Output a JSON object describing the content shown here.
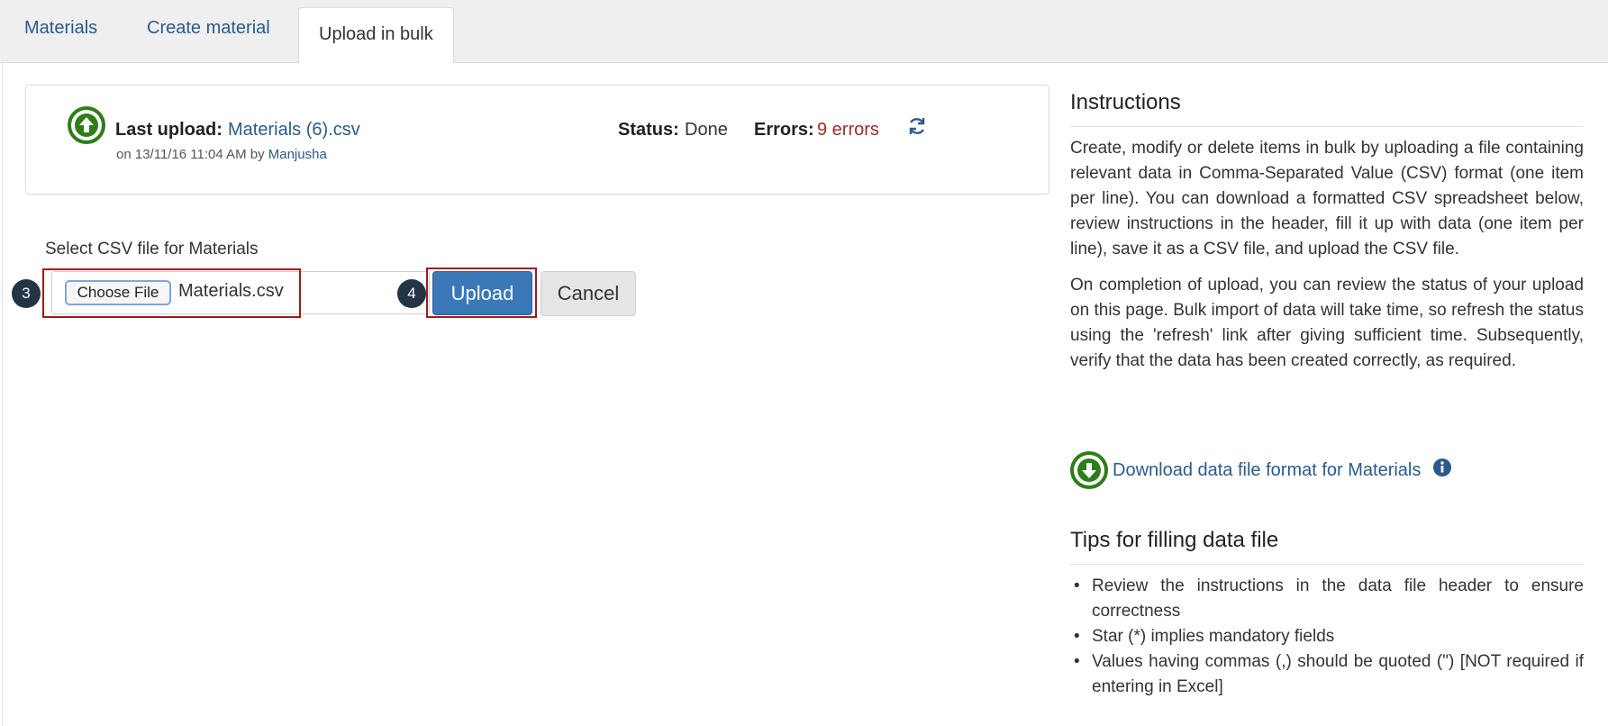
{
  "tabs": [
    {
      "label": "Materials"
    },
    {
      "label": "Create material"
    },
    {
      "label": "Upload in bulk"
    }
  ],
  "last_upload": {
    "label": "Last upload:",
    "file": "Materials (6).csv",
    "meta_prefix": "on 13/11/16 11:04 AM by",
    "user": "Manjusha",
    "status_label": "Status:",
    "status_value": "Done",
    "errors_label": "Errors:",
    "errors_value": "9 errors"
  },
  "upload_form": {
    "select_label": "Select CSV file for Materials",
    "choose_file_label": "Choose File",
    "chosen_file": "Materials.csv",
    "upload_label": "Upload",
    "cancel_label": "Cancel",
    "step_choose": "3",
    "step_upload": "4"
  },
  "instructions": {
    "title": "Instructions",
    "para1": "Create, modify or delete items in bulk by uploading a file containing relevant data in Comma-Separated Value (CSV) format (one item per line). You can download a formatted CSV spreadsheet below, review instructions in the header, fill it up with data (one item per line), save it as a CSV file, and upload the CSV file.",
    "para2": "On completion of upload, you can review the status of your upload on this page. Bulk import of data will take time, so refresh the status using the 'refresh' link after giving sufficient time. Subsequently, verify that the data has been created correctly, as required.",
    "download_link": "Download data file format for Materials"
  },
  "tips": {
    "title": "Tips for filling data file",
    "items": [
      "Review the instructions in the data file header to ensure correctness",
      "Star (*) implies mandatory fields",
      "Values having commas (,) should be quoted (\") [NOT required if entering in Excel]"
    ]
  },
  "colors": {
    "link": "#2a5a8c",
    "primary_button": "#3a78b8",
    "error": "#a12b2b",
    "icon_green": "#2e7d1a",
    "highlight": "#a11a1a"
  }
}
